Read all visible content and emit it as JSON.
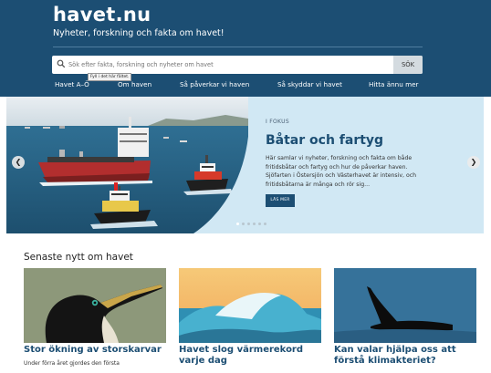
{
  "header": {
    "logo": "havet.nu",
    "tagline": "Nyheter, forskning och fakta om havet!"
  },
  "search": {
    "placeholder": "Sök efter fakta, forskning och nyheter om havet",
    "button_label": "SÖK",
    "tooltip": "Fyll i det här fältet."
  },
  "nav": {
    "items": [
      {
        "label": "Havet A–Ö"
      },
      {
        "label": "Om haven"
      },
      {
        "label": "Så påverkar vi haven"
      },
      {
        "label": "Så skyddar vi havet"
      },
      {
        "label": "Hitta ännu mer"
      }
    ]
  },
  "hero": {
    "kicker": "I FOKUS",
    "title": "Båtar och fartyg",
    "text": "Här samlar vi nyheter, forskning och fakta om både fritidsbåtar och fartyg och hur de påverkar haven. Sjöfarten i Östersjön och Västerhavet är intensiv, och fritidsbåtarna är många och rör sig...",
    "button_label": "LÄS MER",
    "prev_arrow": "❮",
    "next_arrow": "❯",
    "slide_count": 6,
    "active_slide": 1
  },
  "news": {
    "section_title": "Senaste nytt om havet",
    "cards": [
      {
        "title": "Stor ökning av storskarvar",
        "text": "Under förra året gjordes den första"
      },
      {
        "title": "Havet slog värmerekord varje dag",
        "text": ""
      },
      {
        "title": "Kan valar hjälpa oss att förstå klimakteriet?",
        "text": ""
      }
    ]
  },
  "colors": {
    "brand": "#1c4e73",
    "hero_background": "#d1e8f4",
    "search_button": "#d4dbe0"
  }
}
